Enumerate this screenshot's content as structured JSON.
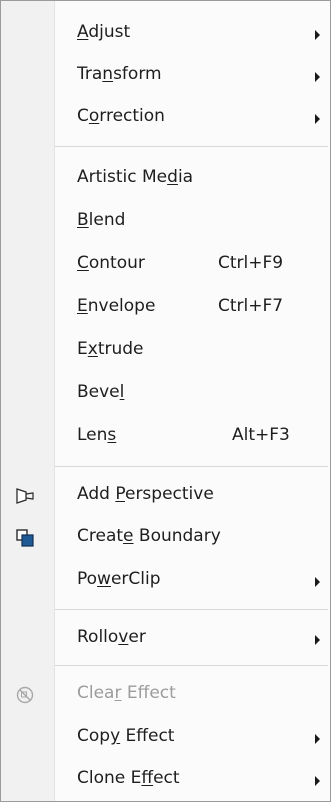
{
  "menu": {
    "items": [
      {
        "label_parts": [
          "",
          "A",
          "djust"
        ],
        "submenu": true
      },
      {
        "label_parts": [
          "Tra",
          "n",
          "sform"
        ],
        "submenu": true
      },
      {
        "label_parts": [
          "C",
          "o",
          "rrection"
        ],
        "submenu": true
      },
      {
        "label_parts": [
          "Artistic Me",
          "d",
          "ia"
        ],
        "submenu": false
      },
      {
        "label_parts": [
          "",
          "B",
          "lend"
        ],
        "submenu": false
      },
      {
        "label_parts": [
          "",
          "C",
          "ontour"
        ],
        "shortcut": "Ctrl+F9",
        "submenu": false
      },
      {
        "label_parts": [
          "",
          "E",
          "nvelope"
        ],
        "shortcut": "Ctrl+F7",
        "submenu": false
      },
      {
        "label_parts": [
          "E",
          "x",
          "trude"
        ],
        "submenu": false
      },
      {
        "label_parts": [
          "Beve",
          "l",
          ""
        ],
        "submenu": false
      },
      {
        "label_parts": [
          "Len",
          "s",
          ""
        ],
        "shortcut": "Alt+F3",
        "submenu": false
      },
      {
        "label_parts": [
          "Add ",
          "P",
          "erspective"
        ],
        "icon": "add-perspective-icon",
        "submenu": false
      },
      {
        "label_parts": [
          "Creat",
          "e",
          " Boundary"
        ],
        "icon": "create-boundary-icon",
        "submenu": false
      },
      {
        "label_parts": [
          "Po",
          "w",
          "erClip"
        ],
        "submenu": true
      },
      {
        "label_parts": [
          "Rollo",
          "v",
          "er"
        ],
        "submenu": true
      },
      {
        "label_parts": [
          "Clea",
          "r",
          " Effect"
        ],
        "icon": "clear-effect-icon",
        "disabled": true,
        "submenu": false
      },
      {
        "label_parts": [
          "Cop",
          "y",
          " Effect"
        ],
        "submenu": true
      },
      {
        "label_parts": [
          "Clone E",
          "f",
          "fect"
        ],
        "submenu": true
      }
    ]
  },
  "colors": {
    "text": "#1e1e1e",
    "disabled_text": "#9c9c9c",
    "gutter": "#f1f1f1",
    "separator": "#d7d7d7",
    "icon_blue": "#1f5a95",
    "icon_dark": "#2b2b2b"
  }
}
